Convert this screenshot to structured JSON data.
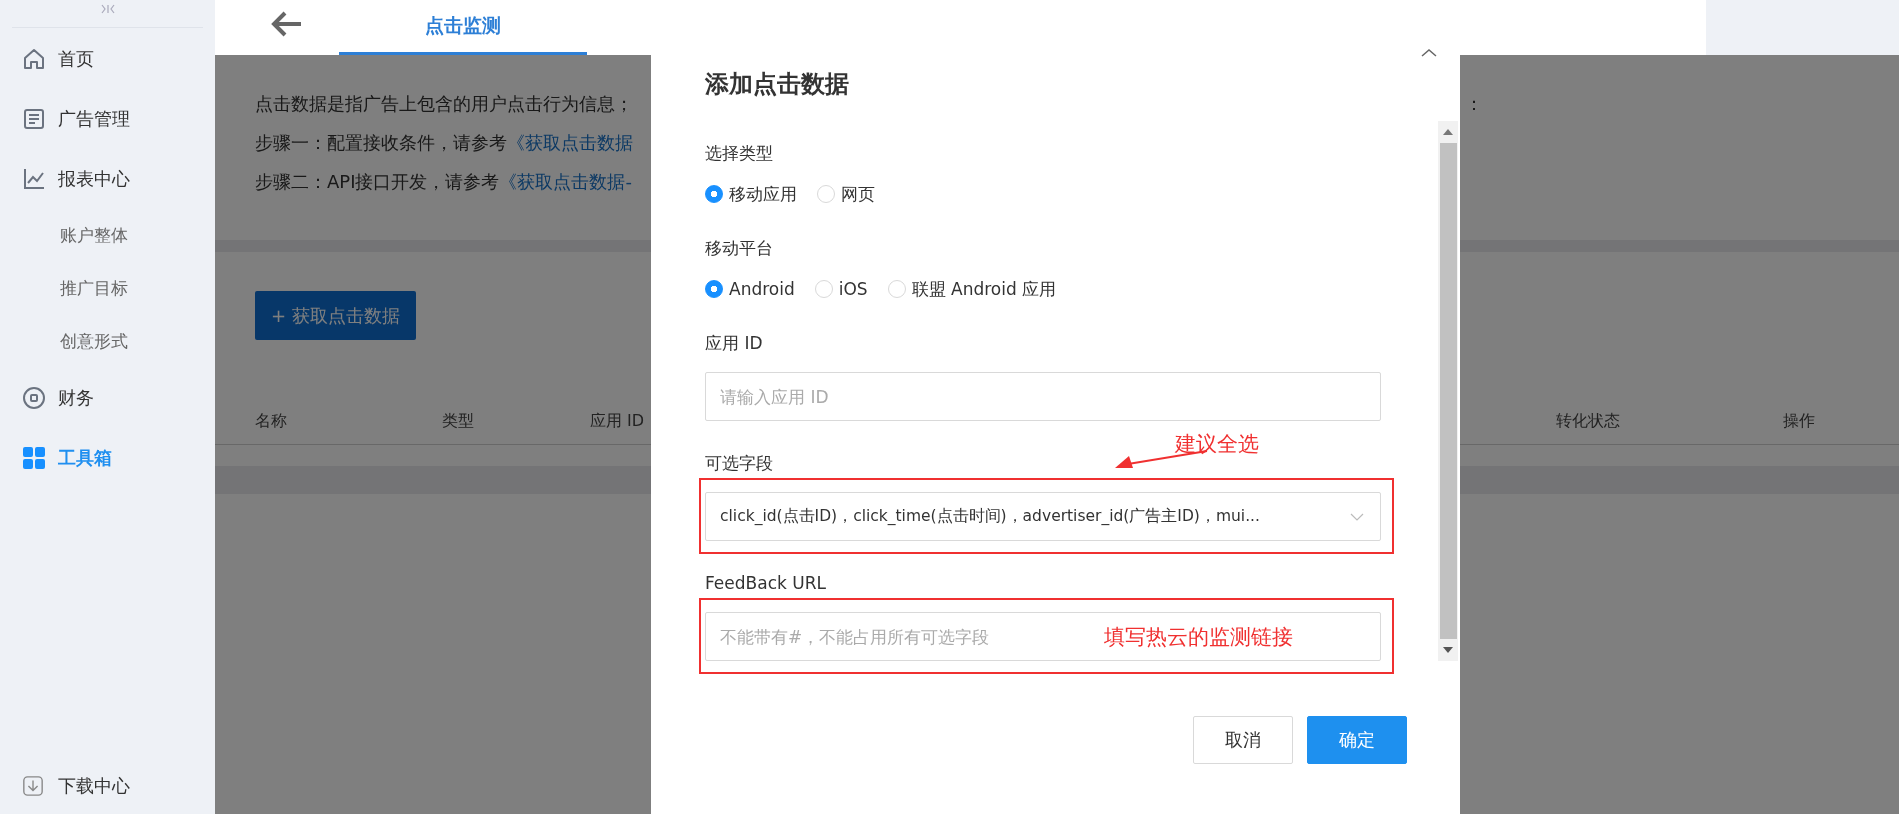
{
  "sidebar": {
    "items": [
      {
        "label": "首页",
        "selected": false
      },
      {
        "label": "广告管理",
        "selected": false
      },
      {
        "label": "报表中心",
        "selected": false,
        "children": [
          {
            "label": "账户整体",
            "selected": false
          },
          {
            "label": "推广目标",
            "selected": false
          },
          {
            "label": "创意形式",
            "selected": false
          }
        ]
      },
      {
        "label": "财务",
        "selected": false
      },
      {
        "label": "工具箱",
        "selected": true
      }
    ],
    "footer": "下载中心"
  },
  "header": {
    "tabs": [
      {
        "label": "点击监测",
        "selected": true
      }
    ]
  },
  "page": {
    "intro": [
      {
        "text": "点击数据是指广告上包含的用户点击行为信息；",
        "tail": "："
      },
      {
        "text": "步骤一：配置接收条件，请参考",
        "link": "《获取点击数据"
      },
      {
        "text": "步骤二：API接口开发，请参考",
        "link": "《获取点击数据-"
      }
    ],
    "add_button": "+ 获取点击数据",
    "table": {
      "columns": [
        "名称",
        "类型",
        "应用 ID",
        "转化状态",
        "操作"
      ]
    }
  },
  "dialog": {
    "title": "添加点击数据",
    "fields": [
      {
        "kind": "radio",
        "label": "选择类型",
        "options": [
          {
            "label": "移动应用",
            "selected": true
          },
          {
            "label": "网页",
            "selected": false
          }
        ]
      },
      {
        "kind": "radio",
        "label": "移动平台",
        "options": [
          {
            "label": "Android",
            "selected": true
          },
          {
            "label": "iOS",
            "selected": false
          },
          {
            "label": "联盟 Android 应用",
            "selected": false
          }
        ]
      },
      {
        "kind": "input",
        "label": "应用 ID",
        "placeholder": "请输入应用 ID",
        "highlighted": false
      },
      {
        "kind": "select",
        "label": "可选字段",
        "value": "click_id(点击ID)，click_time(点击时间)，advertiser_id(广告主ID)，mui...",
        "highlighted": true,
        "note": "建议全选"
      },
      {
        "kind": "input",
        "label": "FeedBack URL",
        "placeholder": "不能带有#，不能占用所有可选字段",
        "highlighted": true,
        "note": "填写热云的监测链接"
      }
    ],
    "buttons": [
      {
        "label": "取消",
        "kind": "secondary"
      },
      {
        "label": "确定",
        "kind": "primary"
      }
    ]
  }
}
